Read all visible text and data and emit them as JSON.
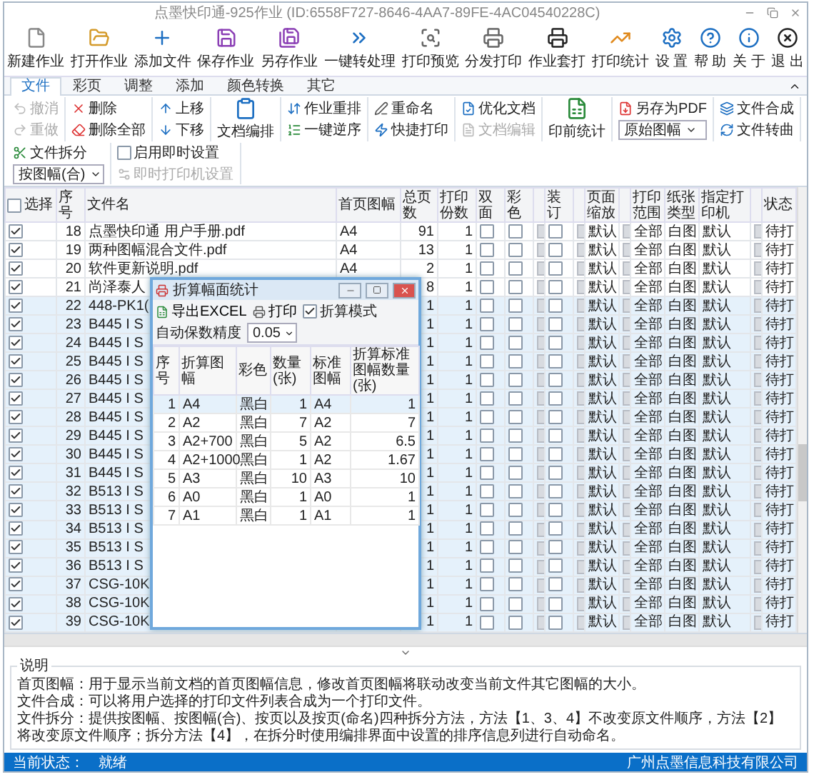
{
  "window": {
    "title": "点墨快印通-925作业 (ID:6558F727-8646-4AA7-89FE-4AC04540228C)"
  },
  "toolbar": [
    {
      "label": "新建作业"
    },
    {
      "label": "打开作业"
    },
    {
      "label": "添加文件"
    },
    {
      "label": "保存作业"
    },
    {
      "label": "另存作业"
    },
    {
      "label": "一键转处理"
    },
    {
      "label": "打印预览"
    },
    {
      "label": "分发打印"
    },
    {
      "label": "作业套打"
    },
    {
      "label": "打印统计"
    },
    {
      "label": "设 置"
    },
    {
      "label": "帮 助"
    },
    {
      "label": "关 于"
    },
    {
      "label": "退 出"
    }
  ],
  "ribbon": {
    "tabs": [
      {
        "label": "文件",
        "selected": true
      },
      {
        "label": "彩页",
        "selected": false
      },
      {
        "label": "调整",
        "selected": false
      },
      {
        "label": "添加",
        "selected": false
      },
      {
        "label": "颜色转换",
        "selected": false
      },
      {
        "label": "其它",
        "selected": false
      }
    ],
    "groups": [
      {
        "items": [
          {
            "kind": "small",
            "label": "撤消",
            "disabled": true
          },
          {
            "kind": "small",
            "label": "重做",
            "disabled": true
          }
        ]
      },
      {
        "items": [
          {
            "kind": "small",
            "label": "删除",
            "disabled": false
          },
          {
            "kind": "small",
            "label": "删除全部",
            "disabled": false
          }
        ]
      },
      {
        "items": [
          {
            "kind": "small",
            "label": "上移",
            "disabled": false
          },
          {
            "kind": "small",
            "label": "下移",
            "disabled": false
          }
        ]
      },
      {
        "items": [
          {
            "kind": "big",
            "label": "文档编排",
            "disabled": false
          }
        ]
      },
      {
        "items": [
          {
            "kind": "small",
            "label": "作业重排",
            "disabled": false
          },
          {
            "kind": "small",
            "label": "一键逆序",
            "disabled": false
          }
        ]
      },
      {
        "items": [
          {
            "kind": "small",
            "label": "重命名",
            "disabled": false
          },
          {
            "kind": "small",
            "label": "快捷打印",
            "disabled": false
          }
        ]
      },
      {
        "items": [
          {
            "kind": "small",
            "label": "优化文档",
            "disabled": false
          },
          {
            "kind": "small",
            "label": "文档编辑",
            "disabled": true
          }
        ]
      },
      {
        "items": [
          {
            "kind": "big",
            "label": "印前统计",
            "disabled": false
          }
        ]
      },
      {
        "items": [
          {
            "kind": "small",
            "label": "另存为PDF",
            "disabled": false
          },
          {
            "kind": "select",
            "value": "原始图幅"
          }
        ]
      },
      {
        "items": [
          {
            "kind": "small",
            "label": "文件合成",
            "disabled": false
          },
          {
            "kind": "small",
            "label": "文件转曲",
            "disabled": false
          }
        ]
      },
      {
        "items": [
          {
            "kind": "small",
            "label": "文件拆分",
            "disabled": false
          },
          {
            "kind": "select",
            "value": "按图幅(合)"
          }
        ]
      },
      {
        "items": [
          {
            "kind": "check",
            "label": "启用即时设置",
            "checked": false
          },
          {
            "kind": "small",
            "label": "即时打印机设置",
            "disabled": true
          }
        ]
      }
    ]
  },
  "table": {
    "select_all": {
      "checked": false
    },
    "columns": [
      {
        "kind": "select",
        "label": "选择"
      },
      {
        "kind": "text",
        "label": "序号"
      },
      {
        "kind": "text",
        "label": "文件名"
      },
      {
        "kind": "text",
        "label": "首页图幅"
      },
      {
        "kind": "text",
        "label": "总页数"
      },
      {
        "kind": "text",
        "label": "打印份数"
      },
      {
        "kind": "text",
        "label": "双面"
      },
      {
        "kind": "text",
        "label": "彩色"
      },
      {
        "kind": "button"
      },
      {
        "kind": "text",
        "label": "装订"
      },
      {
        "kind": "button"
      },
      {
        "kind": "text",
        "label": "页面缩放"
      },
      {
        "kind": "button"
      },
      {
        "kind": "text",
        "label": "打印范围"
      },
      {
        "kind": "text",
        "label": "纸张类型"
      },
      {
        "kind": "text",
        "label": "指定打印机"
      },
      {
        "kind": "button"
      },
      {
        "kind": "text",
        "label": "状态"
      }
    ],
    "rows": [
      {
        "selected": false,
        "checked": true,
        "number": "18",
        "name": "点墨快印通 用户手册.pdf",
        "first_page": "A4",
        "pages": "91",
        "copies": "1",
        "duplex": false,
        "color_print": false,
        "binding": false,
        "scale": "默认",
        "range": "全部",
        "paper": "白图",
        "printer": "默认",
        "status": "待打"
      },
      {
        "selected": false,
        "checked": true,
        "number": "19",
        "name": "两种图幅混合文件.pdf",
        "first_page": "A4",
        "pages": "13",
        "copies": "1",
        "duplex": false,
        "color_print": false,
        "binding": false,
        "scale": "默认",
        "range": "全部",
        "paper": "白图",
        "printer": "默认",
        "status": "待打"
      },
      {
        "selected": false,
        "checked": true,
        "number": "20",
        "name": "软件更新说明.pdf",
        "first_page": "A4",
        "pages": "2",
        "copies": "1",
        "duplex": false,
        "color_print": false,
        "binding": false,
        "scale": "默认",
        "range": "全部",
        "paper": "白图",
        "printer": "默认",
        "status": "待打"
      },
      {
        "selected": false,
        "checked": true,
        "number": "21",
        "name": "尚泽泰人",
        "pages": "8",
        "copies": "1",
        "duplex": false,
        "color_print": false,
        "binding": false,
        "scale": "默认",
        "range": "全部",
        "paper": "白图",
        "printer": "默认",
        "status": "待打"
      },
      {
        "selected": true,
        "checked": true,
        "number": "22",
        "name": "448-PK1(",
        "pages": "1",
        "copies": "1",
        "duplex": false,
        "color_print": false,
        "binding": false,
        "scale": "默认",
        "range": "全部",
        "paper": "白图",
        "printer": "默认",
        "status": "待打"
      },
      {
        "selected": true,
        "checked": true,
        "number": "23",
        "name": "B445 I S",
        "pages": "1",
        "copies": "1",
        "duplex": false,
        "color_print": false,
        "binding": false,
        "scale": "默认",
        "range": "全部",
        "paper": "白图",
        "printer": "默认",
        "status": "待打"
      },
      {
        "selected": true,
        "checked": true,
        "number": "24",
        "name": "B445 I S",
        "pages": "1",
        "copies": "1",
        "duplex": false,
        "color_print": false,
        "binding": false,
        "scale": "默认",
        "range": "全部",
        "paper": "白图",
        "printer": "默认",
        "status": "待打"
      },
      {
        "selected": true,
        "checked": true,
        "number": "25",
        "name": "B445 I S",
        "pages": "1",
        "copies": "1",
        "duplex": false,
        "color_print": false,
        "binding": false,
        "scale": "默认",
        "range": "全部",
        "paper": "白图",
        "printer": "默认",
        "status": "待打"
      },
      {
        "selected": true,
        "checked": true,
        "number": "26",
        "name": "B445 I S",
        "pages": "1",
        "copies": "1",
        "duplex": false,
        "color_print": false,
        "binding": false,
        "scale": "默认",
        "range": "全部",
        "paper": "白图",
        "printer": "默认",
        "status": "待打"
      },
      {
        "selected": true,
        "checked": true,
        "number": "27",
        "name": "B445 I S",
        "pages": "1",
        "copies": "1",
        "duplex": false,
        "color_print": false,
        "binding": false,
        "scale": "默认",
        "range": "全部",
        "paper": "白图",
        "printer": "默认",
        "status": "待打"
      },
      {
        "selected": true,
        "checked": true,
        "number": "28",
        "name": "B445 I S",
        "pages": "1",
        "copies": "1",
        "duplex": false,
        "color_print": false,
        "binding": false,
        "scale": "默认",
        "range": "全部",
        "paper": "白图",
        "printer": "默认",
        "status": "待打"
      },
      {
        "selected": true,
        "checked": true,
        "number": "29",
        "name": "B445 I S",
        "pages": "1",
        "copies": "1",
        "duplex": false,
        "color_print": false,
        "binding": false,
        "scale": "默认",
        "range": "全部",
        "paper": "白图",
        "printer": "默认",
        "status": "待打"
      },
      {
        "selected": true,
        "checked": true,
        "number": "30",
        "name": "B445 I S",
        "pages": "1",
        "copies": "1",
        "duplex": false,
        "color_print": false,
        "binding": false,
        "scale": "默认",
        "range": "全部",
        "paper": "白图",
        "printer": "默认",
        "status": "待打"
      },
      {
        "selected": true,
        "checked": true,
        "number": "31",
        "name": "B445 I S",
        "pages": "1",
        "copies": "1",
        "duplex": false,
        "color_print": false,
        "binding": false,
        "scale": "默认",
        "range": "全部",
        "paper": "白图",
        "printer": "默认",
        "status": "待打"
      },
      {
        "selected": true,
        "checked": true,
        "number": "32",
        "name": "B513 I S",
        "pages": "1",
        "copies": "1",
        "duplex": false,
        "color_print": false,
        "binding": false,
        "scale": "默认",
        "range": "全部",
        "paper": "白图",
        "printer": "默认",
        "status": "待打"
      },
      {
        "selected": true,
        "checked": true,
        "number": "33",
        "name": "B513 I S",
        "pages": "1",
        "copies": "1",
        "duplex": false,
        "color_print": false,
        "binding": false,
        "scale": "默认",
        "range": "全部",
        "paper": "白图",
        "printer": "默认",
        "status": "待打"
      },
      {
        "selected": true,
        "checked": true,
        "number": "34",
        "name": "B513 I S",
        "pages": "1",
        "copies": "1",
        "duplex": false,
        "color_print": false,
        "binding": false,
        "scale": "默认",
        "range": "全部",
        "paper": "白图",
        "printer": "默认",
        "status": "待打"
      },
      {
        "selected": true,
        "checked": true,
        "number": "35",
        "name": "B513 I S",
        "pages": "1",
        "copies": "1",
        "duplex": false,
        "color_print": false,
        "binding": false,
        "scale": "默认",
        "range": "全部",
        "paper": "白图",
        "printer": "默认",
        "status": "待打"
      },
      {
        "selected": true,
        "checked": true,
        "number": "36",
        "name": "B513 I S",
        "pages": "1",
        "copies": "1",
        "duplex": false,
        "color_print": false,
        "binding": false,
        "scale": "默认",
        "range": "全部",
        "paper": "白图",
        "printer": "默认",
        "status": "待打"
      },
      {
        "selected": true,
        "checked": true,
        "number": "37",
        "name": "CSG-10K",
        "pages": "1",
        "copies": "1",
        "duplex": false,
        "color_print": false,
        "binding": false,
        "scale": "默认",
        "range": "全部",
        "paper": "白图",
        "printer": "默认",
        "status": "待打"
      },
      {
        "selected": true,
        "checked": true,
        "number": "38",
        "name": "CSG-10K",
        "pages": "1",
        "copies": "1",
        "duplex": false,
        "color_print": false,
        "binding": false,
        "scale": "默认",
        "range": "全部",
        "paper": "白图",
        "printer": "默认",
        "status": "待打"
      },
      {
        "selected": true,
        "checked": true,
        "number": "39",
        "name": "CSG-10K",
        "pages": "1",
        "copies": "1",
        "duplex": false,
        "color_print": false,
        "binding": false,
        "scale": "默认",
        "range": "全部",
        "paper": "白图",
        "printer": "默认",
        "status": "待打"
      }
    ]
  },
  "dialog": {
    "title": "折算幅面统计",
    "buttons": [
      {
        "label": "导出EXCEL"
      },
      {
        "label": "打印"
      }
    ],
    "mode": {
      "label": "折算模式",
      "checked": true
    },
    "precision": {
      "label": "自动保数精度",
      "value": "0.05"
    },
    "columns": [
      "序号",
      "折算图幅",
      "彩色",
      "数量(张)",
      "标准图幅",
      "折算标准图幅数量(张)"
    ],
    "rows": [
      {
        "selected": true,
        "cells": [
          "1",
          "A4",
          "黑白",
          "1",
          "A4",
          "1"
        ]
      },
      {
        "selected": false,
        "cells": [
          "2",
          "A2",
          "黑白",
          "7",
          "A2",
          "7"
        ]
      },
      {
        "selected": false,
        "cells": [
          "3",
          "A2+700",
          "黑白",
          "5",
          "A2",
          "6.5"
        ]
      },
      {
        "selected": false,
        "cells": [
          "4",
          "A2+1000",
          "黑白",
          "1",
          "A2",
          "1.67"
        ]
      },
      {
        "selected": false,
        "cells": [
          "5",
          "A3",
          "黑白",
          "10",
          "A3",
          "10"
        ]
      },
      {
        "selected": false,
        "cells": [
          "6",
          "A0",
          "黑白",
          "1",
          "A0",
          "1"
        ]
      },
      {
        "selected": false,
        "cells": [
          "7",
          "A1",
          "黑白",
          "1",
          "A1",
          "1"
        ]
      }
    ]
  },
  "notes": {
    "title": "说明",
    "lines": [
      "首页图幅：用于显示当前文档的首页图幅信息，修改首页图幅将联动改变当前文件其它图幅的大小。",
      "文件合成：可以将用户选择的打印文件列表合成为一个打印文件。",
      "文件拆分：提供按图幅、按图幅(合)、按页以及按页(命名)四种拆分方法，方法【1、3、4】不改变原文件顺序，方法【2】将改变原文件顺序；拆分方法【4】，在拆分时使用编排界面中设置的排序信息列进行自动命名。"
    ]
  },
  "status_bar": {
    "label": "当前状态：",
    "value": "就绪",
    "company": "广州点墨信息科技有限公司"
  }
}
